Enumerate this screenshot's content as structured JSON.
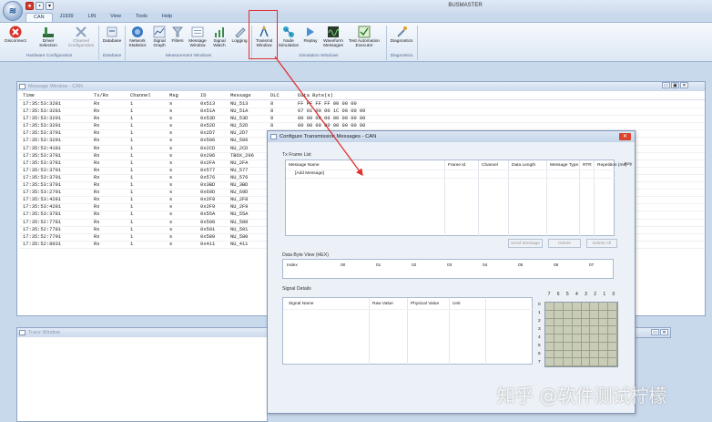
{
  "window": {
    "title": "BUSMASTER",
    "qat_icons": [
      "app-orb-icon",
      "stop-icon",
      "save-icon",
      "dropdown-icon"
    ]
  },
  "ribbon_tabs": [
    "CAN",
    "J1939",
    "LIN",
    "View",
    "Tools",
    "Help"
  ],
  "ribbon": {
    "buttons": [
      {
        "label": "Disconnect",
        "icon": "disconnect-icon"
      },
      {
        "label": "Driver Selection",
        "sub": "Selection ▾",
        "icon": "driver-icon"
      },
      {
        "label": "Channel Configuration",
        "icon": "channel-icon"
      },
      {
        "label": "Database",
        "icon": "database-icon"
      },
      {
        "label": "Network Statistics",
        "icon": "network-icon"
      },
      {
        "label": "Signal Graph",
        "icon": "graph-icon"
      },
      {
        "label": "Filters",
        "icon": "filter-icon"
      },
      {
        "label": "Message Window",
        "icon": "message-window-icon"
      },
      {
        "label": "Signal Watch",
        "icon": "signal-watch-icon"
      },
      {
        "label": "Logging",
        "icon": "logging-icon"
      },
      {
        "label": "Transmit Window",
        "icon": "transmit-icon"
      },
      {
        "label": "Node Simulation",
        "icon": "node-icon"
      },
      {
        "label": "Replay",
        "icon": "replay-icon"
      },
      {
        "label": "Waveform Messages",
        "icon": "waveform-icon"
      },
      {
        "label": "Test Automation Executor",
        "icon": "test-icon"
      },
      {
        "label": "Diagnostics",
        "icon": "diagnostics-icon"
      }
    ],
    "groups": [
      "Hardware Configuration",
      "Database",
      "Measurement Windows",
      "Simulation Windows",
      "Diagnostics"
    ]
  },
  "message_window": {
    "title": "Message Window - CAN",
    "columns": [
      "Time",
      "Tx/Rx",
      "Channel",
      "Msg",
      "ID",
      "Message",
      "DLC",
      "Data Byte(s)"
    ],
    "rows": [
      [
        "17:35:53:3281",
        "Rx",
        "1",
        "s",
        "0x513",
        "NU_513",
        "8",
        "FF FF FF FF 00 00 00"
      ],
      [
        "17:35:53:3281",
        "Rx",
        "1",
        "s",
        "0x51A",
        "NU_51A",
        "8",
        "07 01 00 00 1C 00 00 00"
      ],
      [
        "17:35:53:3291",
        "Rx",
        "1",
        "s",
        "0x53D",
        "NU_53D",
        "8",
        "00 00 00 00 00 00 00 00"
      ],
      [
        "17:35:53:3291",
        "Rx",
        "1",
        "s",
        "0x52D",
        "NU_52D",
        "8",
        "00 00 00 00 00 00 00 00"
      ],
      [
        "17:35:53:3791",
        "Rx",
        "1",
        "s",
        "0x2D7",
        "NU_2D7",
        "",
        ""
      ],
      [
        "17:35:53:3291",
        "Rx",
        "1",
        "s",
        "0x506",
        "NU_506",
        "",
        ""
      ],
      [
        "17:35:53:4181",
        "Rx",
        "1",
        "s",
        "0x2CD",
        "NU_2CD",
        "",
        ""
      ],
      [
        "17:35:53:3781",
        "Rx",
        "1",
        "s",
        "0x296",
        "TBOX_296",
        "",
        ""
      ],
      [
        "17:35:53:3781",
        "Rx",
        "1",
        "s",
        "0x2FA",
        "NU_2FA",
        "",
        ""
      ],
      [
        "17:35:53:3791",
        "Rx",
        "1",
        "s",
        "0x577",
        "NU_577",
        "",
        ""
      ],
      [
        "17:35:53:3791",
        "Rx",
        "1",
        "s",
        "0x576",
        "NU_576",
        "",
        ""
      ],
      [
        "17:35:53:3791",
        "Rx",
        "1",
        "s",
        "0x3BD",
        "NU_3BD",
        "",
        ""
      ],
      [
        "17:35:53:2791",
        "Rx",
        "1",
        "s",
        "0x69D",
        "NU_69D",
        "",
        ""
      ],
      [
        "17:35:53:4281",
        "Rx",
        "1",
        "s",
        "0x2F8",
        "NU_2F8",
        "",
        ""
      ],
      [
        "17:35:53:4281",
        "Rx",
        "1",
        "s",
        "0x2F9",
        "NU_2F9",
        "",
        ""
      ],
      [
        "17:35:53:3781",
        "Rx",
        "1",
        "s",
        "0x55A",
        "NU_55A",
        "",
        ""
      ],
      [
        "17:35:52:7781",
        "Rx",
        "1",
        "s",
        "0x500",
        "NU_500",
        "",
        ""
      ],
      [
        "17:35:52:7781",
        "Rx",
        "1",
        "s",
        "0x501",
        "NU_501",
        "",
        ""
      ],
      [
        "17:35:52:7791",
        "Rx",
        "1",
        "s",
        "0x580",
        "NU_580",
        "",
        ""
      ],
      [
        "17:35:52:8031",
        "Rx",
        "1",
        "s",
        "0x411",
        "NU_411",
        "",
        ""
      ]
    ]
  },
  "trace_window": {
    "title": "Trace Window"
  },
  "dialog": {
    "title": "Configure Transmission Messages - CAN",
    "tx_frame_list": {
      "label": "Tx Frame List",
      "columns": [
        "Message Name",
        "Frame Id",
        "Channel",
        "Data Length",
        "Message Type",
        "RTR",
        "Repetition (ms)",
        "Key"
      ],
      "first_row": "[Add Message]"
    },
    "buttons": {
      "send": "Send Message",
      "delete": "Delete",
      "delete_all": "Delete All"
    },
    "data_byte_view": {
      "label": "Data Byte View (HEX)",
      "index_label": "Index",
      "indices": [
        "00",
        "01",
        "02",
        "03",
        "04",
        "05",
        "06",
        "07"
      ]
    },
    "signal_details": {
      "label": "Signal Details",
      "columns": [
        "Signal Name",
        "Raw Value",
        "Physical Value",
        "Unit"
      ]
    },
    "bit_matrix": {
      "col_labels": [
        "7",
        "6",
        "5",
        "4",
        "3",
        "2",
        "1",
        "0"
      ],
      "row_labels": [
        "0",
        "1",
        "2",
        "3",
        "4",
        "5",
        "6",
        "7"
      ]
    }
  },
  "watermark": "知乎 @软件测试柠檬",
  "colors": {
    "highlight": "#e03030",
    "accent": "#2a5f9a"
  }
}
